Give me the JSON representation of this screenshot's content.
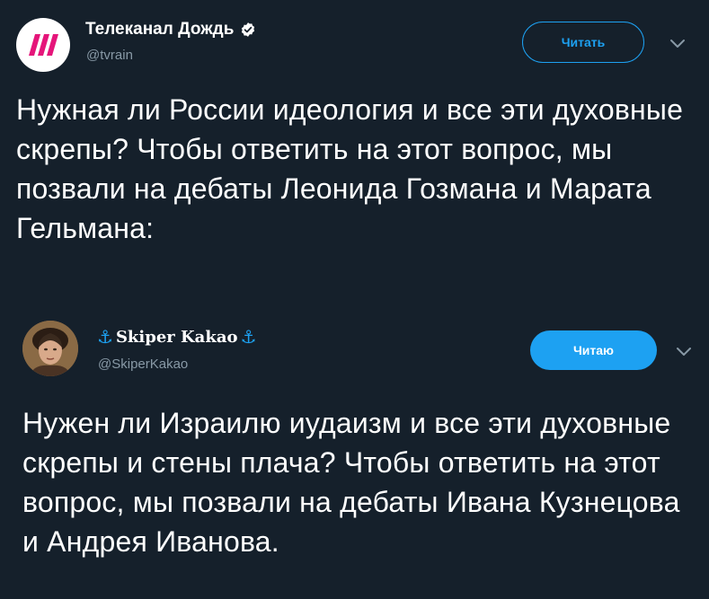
{
  "tweet1": {
    "author_name": "Телеканал Дождь",
    "author_handle": "@tvrain",
    "verified": true,
    "follow_button_label": "Читать",
    "body_text": "Нужная ли России идеология и все эти духовные скрепы? Чтобы ответить на этот вопрос, мы позвали на дебаты Леонида Гозмана и Марата Гельмана:"
  },
  "tweet2": {
    "anchor_left": "⚓",
    "author_name": "Skiper Kakao",
    "anchor_right": "⚓",
    "author_handle": "@SkiperKakao",
    "follow_button_label": "Читаю",
    "body_text": "Нужен ли Израилю иудаизм и все эти духовные скрепы и стены плача? Чтобы ответить на этот вопрос, мы позвали на дебаты Ивана Кузнецова и Андрея Иванова."
  },
  "colors": {
    "background": "#15202b",
    "accent": "#1da1f2",
    "secondary_text": "#8899a6",
    "logo_stripes": "#e5157a"
  },
  "icons": [
    "tvrain-logo-icon",
    "verified-badge-icon",
    "chevron-down-icon",
    "anchor-icon",
    "avatar-portrait"
  ]
}
